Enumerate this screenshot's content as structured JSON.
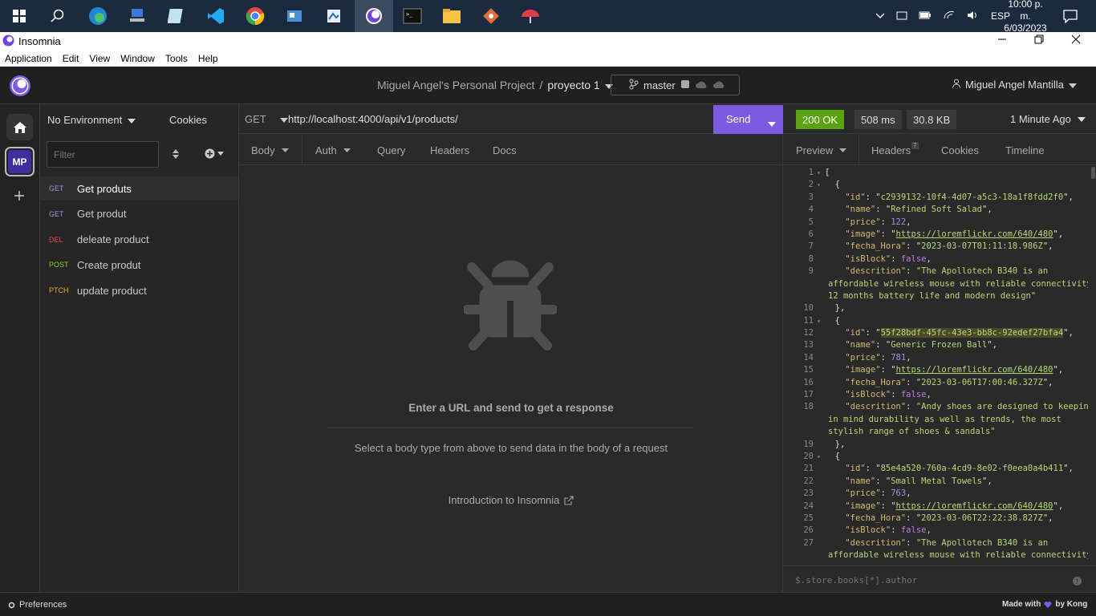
{
  "taskbar": {
    "lang": "ESP",
    "time": "10:00 p. m.",
    "date": "6/03/2023"
  },
  "window": {
    "title": "Insomnia",
    "menu": [
      "Application",
      "Edit",
      "View",
      "Window",
      "Tools",
      "Help"
    ]
  },
  "header": {
    "project": "Miguel Angel's Personal Project",
    "separator": "/",
    "collection": "proyecto 1",
    "branch": "master",
    "user": "Miguel Angel Mantilla"
  },
  "sidebar": {
    "avatar": "MP"
  },
  "requests": {
    "environment": "No Environment",
    "cookies": "Cookies",
    "filter_placeholder": "Filter",
    "items": [
      {
        "method": "GET",
        "name": "Get produts",
        "color": "#a58ae0"
      },
      {
        "method": "GET",
        "name": "Get produt",
        "color": "#a58ae0"
      },
      {
        "method": "DEL",
        "name": "deleate product",
        "color": "#e5484d"
      },
      {
        "method": "POST",
        "name": "Create produt",
        "color": "#7ed321"
      },
      {
        "method": "PTCH",
        "name": "update product",
        "color": "#f5a623"
      }
    ]
  },
  "urlbar": {
    "method": "GET",
    "url": "http://localhost:4000/api/v1/products/",
    "send": "Send"
  },
  "req_tabs": [
    "Body",
    "Auth",
    "Query",
    "Headers",
    "Docs"
  ],
  "empty": {
    "title": "Enter a URL and send to get a response",
    "subtitle": "Select a body type from above to send data in the body of a request",
    "link": "Introduction to Insomnia"
  },
  "response": {
    "status": "200 OK",
    "time": "508 ms",
    "size": "30.8 KB",
    "ago": "1 Minute Ago",
    "tabs": [
      "Preview",
      "Headers",
      "Cookies",
      "Timeline"
    ],
    "headers_count": "7",
    "filter_placeholder": "$.store.books[*].author",
    "json": [
      {
        "id": "c2939132-10f4-4d07-a5c3-18a1f8fdd2f0",
        "name": "Refined Soft Salad",
        "price": "122",
        "image": "https://loremflickr.com/640/480",
        "fecha": "2023-03-07T01:11:18.986Z",
        "isBlock": "false",
        "desc1": "\"The Apollotech B340 is an",
        "desc2": "affordable wireless mouse with reliable connectivity,",
        "desc3": "12 months battery life and modern design\""
      },
      {
        "id": "55f28bdf-45fc-43e3-bb8c-92edef27bfa4",
        "name": "Generic Frozen Ball",
        "price": "781",
        "image": "https://loremflickr.com/640/480",
        "fecha": "2023-03-06T17:00:46.327Z",
        "isBlock": "false",
        "desc1": "\"Andy shoes are designed to keeping",
        "desc2": "in mind durability as well as trends, the most",
        "desc3": "stylish range of shoes & sandals\""
      },
      {
        "id": "85e4a520-760a-4cd9-8e02-f0eea0a4b411",
        "name": "Small Metal Towels",
        "price": "763",
        "image": "https://loremflickr.com/640/480",
        "fecha": "2023-03-06T22:22:38.827Z",
        "isBlock": "false",
        "desc1": "\"The Apollotech B340 is an",
        "desc2": "affordable wireless mouse with reliable connectivity,"
      }
    ]
  },
  "status": {
    "preferences": "Preferences",
    "made_with": "Made with",
    "by": "by Kong"
  },
  "colors": {
    "accent": "#7b5ce0",
    "ok": "#59a210"
  }
}
